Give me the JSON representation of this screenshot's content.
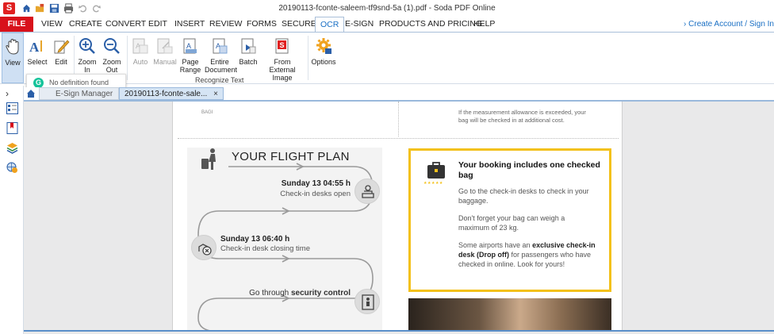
{
  "app": {
    "logo": "S",
    "window_title": "20190113-fconte-saleem-tf9snd-5a (1).pdf - Soda PDF Online"
  },
  "menu": {
    "file": "FILE",
    "items": [
      "VIEW",
      "CREATE",
      "CONVERT",
      "EDIT",
      "INSERT",
      "REVIEW",
      "FORMS",
      "SECURE",
      "OCR",
      "E-SIGN",
      "PRODUCTS AND PRICING",
      "HELP"
    ],
    "active": "OCR",
    "create_account": "› Create Account / Sign In"
  },
  "ribbon": {
    "view": "View",
    "select": "Select",
    "edit": "Edit",
    "zoom_in": [
      "Zoom",
      "In"
    ],
    "zoom_out": [
      "Zoom",
      "Out"
    ],
    "auto": "Auto",
    "manual": "Manual",
    "page_range": [
      "Page",
      "Range"
    ],
    "entire_document": [
      "Entire",
      "Document"
    ],
    "batch": "Batch",
    "from_external_image": [
      "From External",
      "Image"
    ],
    "options": "Options",
    "group_recognize": "Recognize Text"
  },
  "popup": {
    "icon": "G",
    "text": "No definition found"
  },
  "tabs": {
    "collapse": "›",
    "esign_manager": "E-Sign Manager",
    "document": "20190113-fconte-sale...",
    "close": "×"
  },
  "page": {
    "top_left_fragment": "BAGI",
    "top_right_text": [
      "If the measurement allowance is exceeded, your",
      "bag will be checked in at additional cost."
    ],
    "flight_title": "YOUR FLIGHT PLAN",
    "step1_time": "Sunday 13 04:55 h",
    "step1_desc": "Check-in desks open",
    "step2_time": "Sunday 13 06:40 h",
    "step2_desc": "Check-in desk closing time",
    "step3_prefix": "Go through ",
    "step3_bold": "security control",
    "booking_title": [
      "Your booking includes one checked",
      "bag"
    ],
    "booking_stars": "★★★★★",
    "booking_p1": [
      "Go to the check-in desks to check in your",
      "baggage."
    ],
    "booking_p2": [
      "Don't forget your bag can weigh a",
      "maximum of 23 kg."
    ],
    "booking_p3_a": "Some airports have an ",
    "booking_p3_bold1": "exclusive check-in",
    "booking_p3_bold2": "desk (Drop off)",
    "booking_p3_b": " for passengers who have",
    "booking_p3_c": "checked in online. Look for yours!"
  },
  "colors": {
    "accent": "#1a6fc4",
    "file_red": "#d8111b",
    "highlight_yellow": "#f3c11b"
  }
}
